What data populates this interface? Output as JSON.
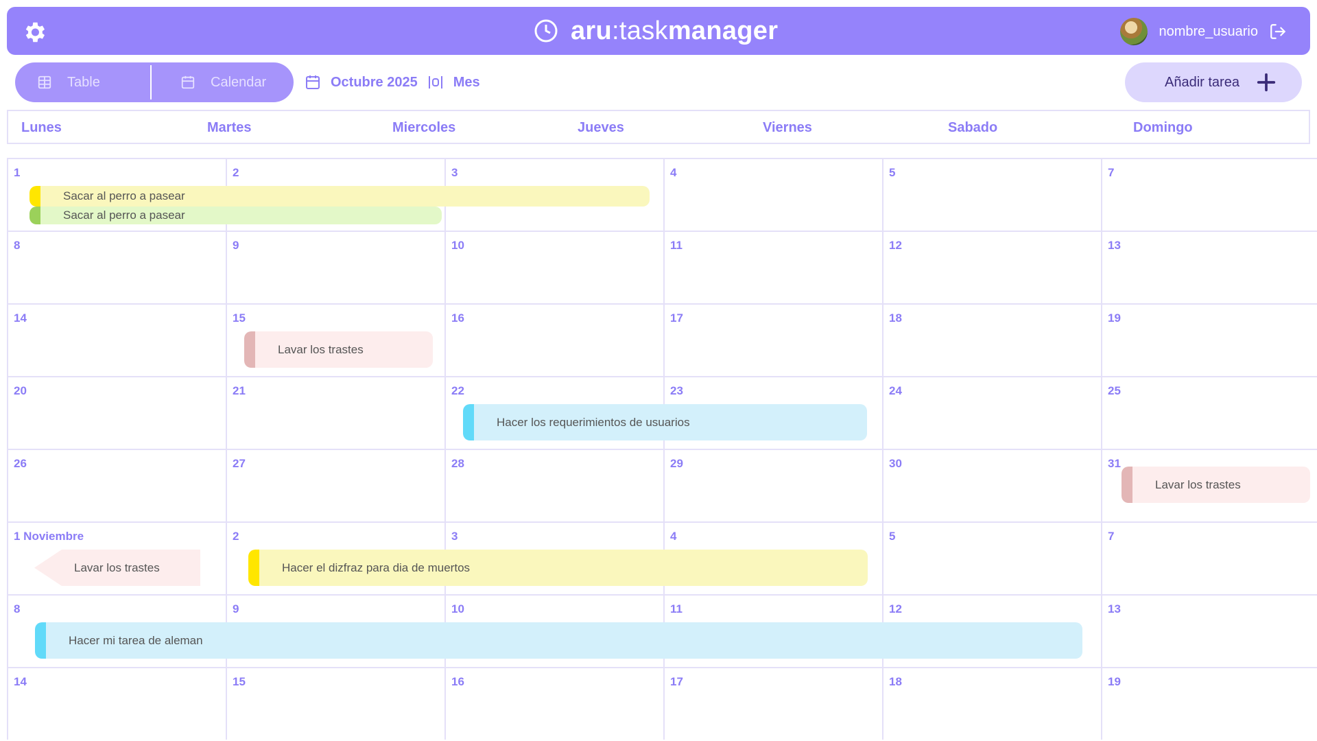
{
  "header": {
    "brand_bold": "aru",
    "brand_sep": ":",
    "brand_light": "task",
    "brand_bold2": "manager",
    "username": "nombre_usuario"
  },
  "toolbar": {
    "view_table": "Table",
    "view_calendar": "Calendar",
    "month_label": "Octubre 2025",
    "range_label": "Mes",
    "add_task": "Añadir tarea"
  },
  "weekdays": [
    "Lunes",
    "Martes",
    "Miercoles",
    "Jueves",
    "Viernes",
    "Sabado",
    "Domingo"
  ],
  "weeks": [
    [
      "1",
      "2",
      "3",
      "4",
      "5",
      "7",
      ""
    ],
    [
      "8",
      "9",
      "10",
      "11",
      "12",
      "13",
      ""
    ],
    [
      "14",
      "15",
      "16",
      "17",
      "18",
      "19",
      ""
    ],
    [
      "20",
      "21",
      "22",
      "23",
      "24",
      "25",
      ""
    ],
    [
      "26",
      "27",
      "28",
      "29",
      "30",
      "31",
      ""
    ],
    [
      "1 Noviembre",
      "2",
      "3",
      "4",
      "5",
      "7",
      ""
    ],
    [
      "8",
      "9",
      "10",
      "11",
      "12",
      "13",
      ""
    ],
    [
      "14",
      "15",
      "16",
      "17",
      "18",
      "19",
      ""
    ]
  ],
  "events": [
    {
      "title": "Sacar al perro a pasear",
      "color": "yellow"
    },
    {
      "title": "Sacar al perro a pasear",
      "color": "green"
    },
    {
      "title": "Lavar los trastes",
      "color": "pink"
    },
    {
      "title": "Hacer los requerimientos de usuarios",
      "color": "blue"
    },
    {
      "title": "Lavar los trastes",
      "color": "pink"
    },
    {
      "title": "Lavar los trastes",
      "color": "pink"
    },
    {
      "title": "Hacer el dizfraz para dia de muertos",
      "color": "yellow"
    },
    {
      "title": "Hacer mi tarea de aleman",
      "color": "blue"
    }
  ],
  "colors": {
    "header_bg": "#9583fb",
    "accent": "#8b7cf6",
    "yellow": "#ffe600",
    "green": "#9bd15a",
    "pink": "#e3b6b6",
    "blue": "#61daf9"
  }
}
